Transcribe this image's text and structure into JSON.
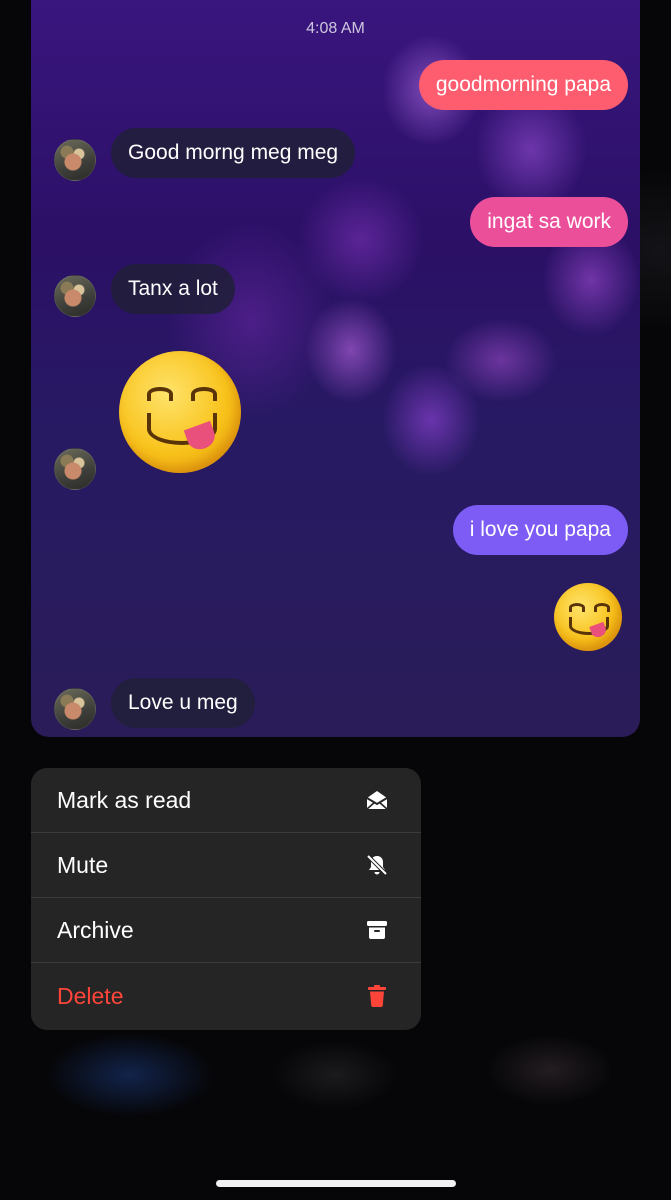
{
  "chat": {
    "timestamp": "4:08 AM",
    "messages": [
      {
        "direction": "outgoing",
        "text": "goodmorning papa",
        "color": "#fe5c6f"
      },
      {
        "direction": "incoming",
        "text": "Good morng meg meg"
      },
      {
        "direction": "outgoing",
        "text": "ingat sa work",
        "color": "#ec4f9a"
      },
      {
        "direction": "incoming",
        "text": "Tanx a lot"
      },
      {
        "direction": "incoming",
        "emoji": "face-savoring-food"
      },
      {
        "direction": "outgoing",
        "text": "i love you papa",
        "color": "#7c5cf4"
      },
      {
        "direction": "outgoing",
        "emoji": "face-savoring-food"
      },
      {
        "direction": "incoming",
        "text": "Love u meg"
      }
    ]
  },
  "menu": {
    "items": [
      {
        "label": "Mark as read",
        "icon": "mark-as-read-icon"
      },
      {
        "label": "Mute",
        "icon": "bell-slash-icon"
      },
      {
        "label": "Archive",
        "icon": "archive-box-icon"
      },
      {
        "label": "Delete",
        "icon": "trash-icon",
        "color": "#ff453a"
      }
    ]
  }
}
